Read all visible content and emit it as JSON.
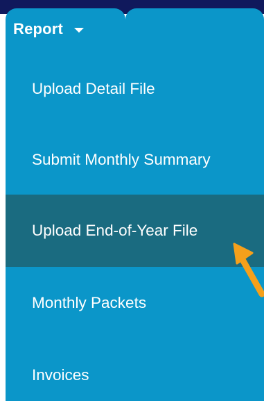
{
  "nav": {
    "report_tab": {
      "label": "Report",
      "icon": "caret-down-icon"
    }
  },
  "menu": {
    "items": [
      {
        "label": "Upload Detail File",
        "active": false
      },
      {
        "label": "Submit Monthly Summary",
        "active": false
      },
      {
        "label": "Upload End-of-Year File",
        "active": true
      },
      {
        "label": "Monthly Packets",
        "active": false
      },
      {
        "label": "Invoices",
        "active": false
      }
    ]
  },
  "annotation": {
    "icon": "pointer-arrow-icon",
    "color": "#f5a01b"
  },
  "colors": {
    "nav_dark": "#10195c",
    "menu_bg": "#0b96c9",
    "menu_active": "#1a6b80",
    "text": "#ffffff"
  }
}
